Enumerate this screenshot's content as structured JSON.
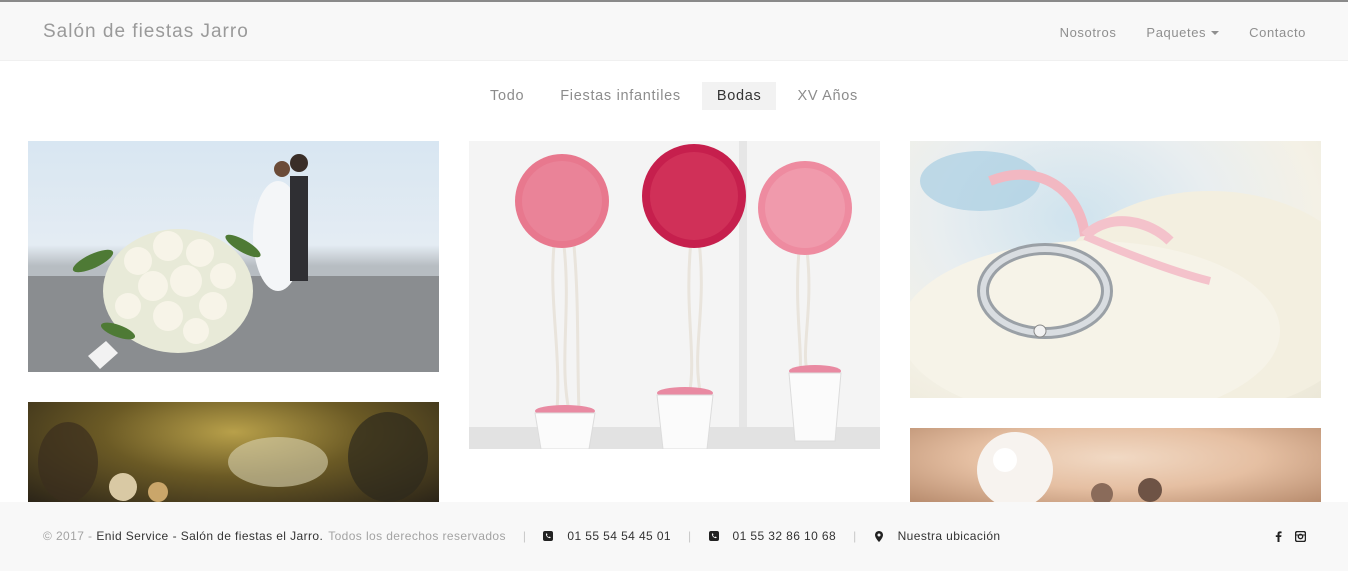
{
  "brand": "Salón de fiestas Jarro",
  "nav": {
    "nosotros": "Nosotros",
    "paquetes": "Paquetes",
    "contacto": "Contacto"
  },
  "filters": [
    "Todo",
    "Fiestas infantiles",
    "Bodas",
    "XV Años"
  ],
  "active_filter": "Bodas",
  "gallery": [
    {
      "subject": "wedding-bouquet-couple"
    },
    {
      "subject": "pink-flower-topiaries"
    },
    {
      "subject": "wedding-ring-ribbon"
    },
    {
      "subject": "wedding-cake-figurines"
    },
    {
      "subject": "couple-figurines-balloon"
    }
  ],
  "footer": {
    "copyright": "© 2017 -",
    "company": "Enid Service",
    "tagline": "- Salón de fiestas el Jarro.",
    "rights": "Todos los derechos reservados",
    "phone1": "01 55 54 54 45 01",
    "phone2": "01 55 32 86 10 68",
    "location": "Nuestra ubicación"
  },
  "colors": {
    "navbar_bg": "#f8f8f8",
    "text_muted": "#8f8f8f",
    "text_dark": "#333333",
    "active_filter_bg": "#f2f2f2"
  }
}
